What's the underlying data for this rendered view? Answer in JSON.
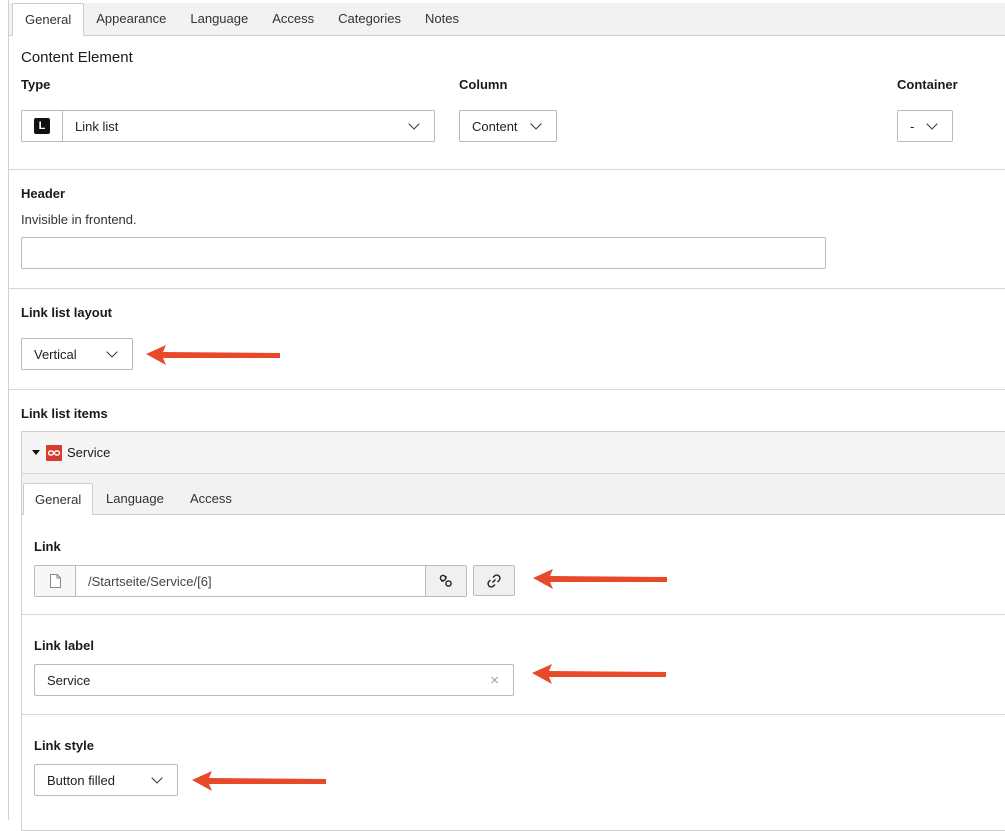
{
  "tabs": [
    "General",
    "Appearance",
    "Language",
    "Access",
    "Categories",
    "Notes"
  ],
  "section_title": "Content Element",
  "type": {
    "label": "Type",
    "value": "Link list",
    "icon": "L"
  },
  "column": {
    "label": "Column",
    "value": "Content"
  },
  "container": {
    "label": "Container",
    "value": "-"
  },
  "header": {
    "label": "Header",
    "description": "Invisible in frontend.",
    "value": ""
  },
  "link_list_layout": {
    "label": "Link list layout",
    "value": "Vertical"
  },
  "link_list_items": {
    "label": "Link list items",
    "record_title": "Service",
    "tabs": [
      "General",
      "Language",
      "Access"
    ],
    "link": {
      "label": "Link",
      "value": "/Startseite/Service/[6]"
    },
    "link_label": {
      "label": "Link label",
      "value": "Service"
    },
    "link_style": {
      "label": "Link style",
      "value": "Button filled"
    }
  },
  "colors": {
    "arrow": "#e8492b",
    "record_icon": "#d93a2b"
  }
}
